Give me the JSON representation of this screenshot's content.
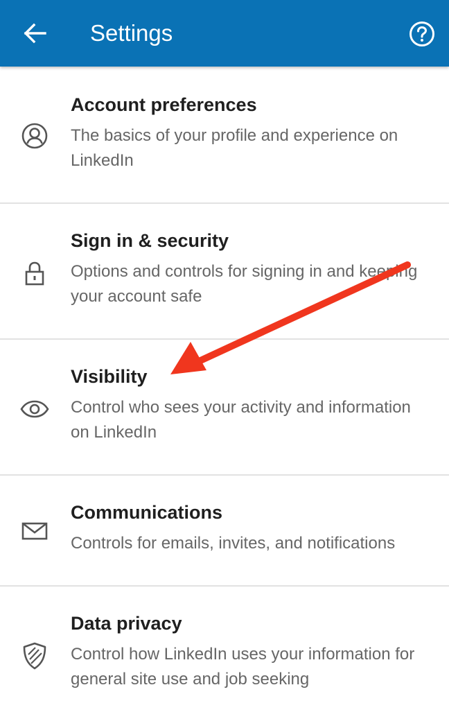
{
  "header": {
    "title": "Settings",
    "back_icon": "arrow-left-icon",
    "help_icon": "help-circle-icon",
    "background": "#0a72b5"
  },
  "items": [
    {
      "icon": "profile-circle-icon",
      "title": "Account preferences",
      "description": "The basics of your profile and experience on LinkedIn"
    },
    {
      "icon": "lock-icon",
      "title": "Sign in & security",
      "description": "Options and controls for signing in and keeping your account safe"
    },
    {
      "icon": "eye-icon",
      "title": "Visibility",
      "description": "Control who sees your activity and information on LinkedIn"
    },
    {
      "icon": "envelope-icon",
      "title": "Communications",
      "description": "Controls for emails, invites, and notifications"
    },
    {
      "icon": "shield-icon",
      "title": "Data privacy",
      "description": "Control how LinkedIn uses your information for general site use and job seeking"
    }
  ],
  "annotation": {
    "type": "arrow",
    "color": "#f0361e",
    "points_to": "Visibility"
  }
}
